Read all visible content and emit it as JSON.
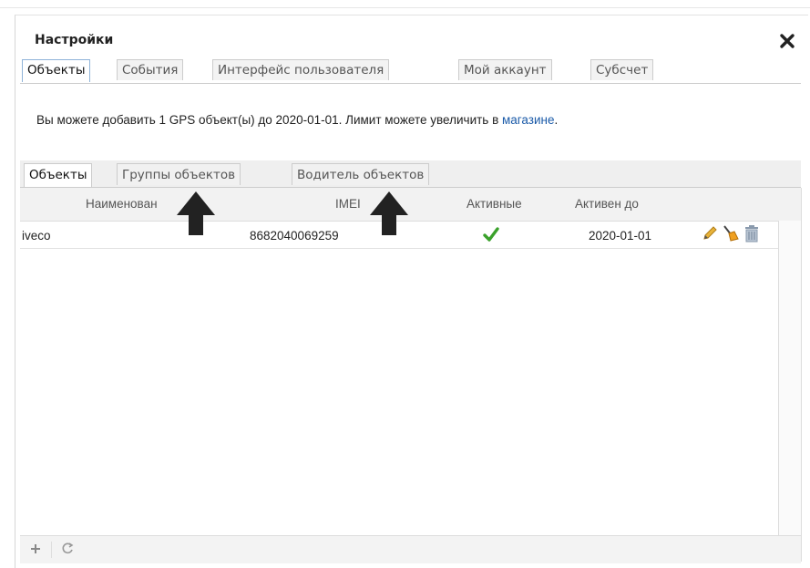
{
  "dialog": {
    "title": "Настройки"
  },
  "top_tabs": [
    {
      "label": "Объекты",
      "active": true
    },
    {
      "label": "События",
      "active": false
    },
    {
      "label": "Интерфейс пользователя",
      "active": false
    },
    {
      "label": "Мой аккаунт",
      "active": false
    },
    {
      "label": "Субсчет",
      "active": false
    }
  ],
  "notice": {
    "text": "Вы можете добавить 1 GPS объект(ы) до 2020-01-01. Лимит можете увеличить в ",
    "link": "магазине",
    "suffix": "."
  },
  "sub_tabs": [
    {
      "label": "Объекты",
      "active": true
    },
    {
      "label": "Группы объектов",
      "active": false
    },
    {
      "label": "Водитель объектов",
      "active": false
    }
  ],
  "table": {
    "headers": {
      "name": "Наименован",
      "imei": "IMEI",
      "active": "Активные",
      "active_until": "Активен до"
    },
    "rows": [
      {
        "name": "iveco",
        "imei": "8682040069259",
        "active_until": "2020-01-01"
      }
    ]
  },
  "icons": {
    "close": "close-icon",
    "check": "check-icon",
    "edit": "pencil-icon",
    "clear": "broom-icon",
    "delete": "trash-icon",
    "add": "plus-icon",
    "refresh": "refresh-icon"
  },
  "colors": {
    "link": "#1a5aa8",
    "check": "#3aa12b"
  }
}
